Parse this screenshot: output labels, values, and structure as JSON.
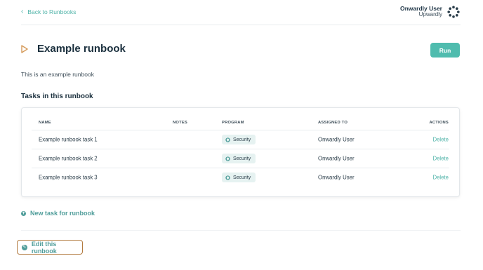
{
  "header": {
    "back_link": "Back to Runbooks",
    "user_name": "Onwardly User",
    "org_name": "Upwardly",
    "icons": {
      "back": "chevron-left-icon",
      "logo": "org-logo-icon"
    }
  },
  "runbook": {
    "title": "Example runbook",
    "run_label": "Run",
    "description": "This is an example runbook",
    "icons": {
      "title": "play-icon"
    }
  },
  "tasks_section": {
    "title": "Tasks in this runbook",
    "columns": [
      "NAME",
      "NOTES",
      "PROGRAM",
      "ASSIGNED TO",
      "ACTIONS"
    ],
    "rows": [
      {
        "name": "Example runbook task 1",
        "notes": "",
        "program": "Security",
        "assigned_to": "Onwardly User",
        "action": "Delete"
      },
      {
        "name": "Example runbook task 2",
        "notes": "",
        "program": "Security",
        "assigned_to": "Onwardly User",
        "action": "Delete"
      },
      {
        "name": "Example runbook task 3",
        "notes": "",
        "program": "Security",
        "assigned_to": "Onwardly User",
        "action": "Delete"
      }
    ],
    "program_icon": "shield-icon"
  },
  "footer": {
    "new_task_label": "New task for runbook",
    "edit_label": "Edit this runbook",
    "icons": {
      "new_task": "plus-circle-icon",
      "edit": "edit-circle-icon"
    }
  },
  "colors": {
    "accent": "#4fbcae",
    "link": "#4fb3a8",
    "title_icon": "#d59a5a",
    "focus_outline": "#b27a3f"
  }
}
